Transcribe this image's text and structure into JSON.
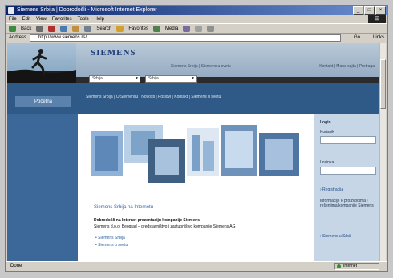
{
  "window": {
    "title": "Siemens Srbija | Dobrodošli - Microsoft Internet Explorer",
    "buttons": [
      "_",
      "□",
      "×"
    ]
  },
  "menu": {
    "items": [
      "File",
      "Edit",
      "View",
      "Favorites",
      "Tools",
      "Help"
    ]
  },
  "toolbar": {
    "back_label": "Back",
    "search_label": "Search",
    "favorites_label": "Favorites",
    "media_label": "Media"
  },
  "address": {
    "label": "Address",
    "url": "http://www.siemens.rs/",
    "go_label": "Go",
    "links_label": "Links"
  },
  "site": {
    "logo": "SIEMENS",
    "header_mid": "Siemens Srbija | Siemens u svetu",
    "header_right": "Kontakt | Mapa sajta | Pretraga",
    "select1": "Srbija",
    "select2": "Srbija",
    "nav_home": "Početna",
    "nav_links": "Siemens Srbija | O Siemensu | Novosti | Poslovi | Kontakt | Siemens u svetu",
    "promo_title": "Siemens Srbija na Internetu",
    "intro_line1": "Dobrodošli na Internet prezentaciju kompanije Siemens",
    "intro_line2": "Siemens d.o.o. Beograd – predstavništvo i zastupništvo kompanije Siemens AG",
    "bullets": [
      "Siemens Srbija",
      "Siemens u svetu"
    ],
    "sidebar": {
      "title": "Login",
      "user_label": "Korisnik",
      "pass_label": "Lozinka",
      "link1": "› Registracija",
      "text": "Informacije o proizvodima i rešenjima kompanije Siemens",
      "link2": "› Siemens u Srbiji"
    }
  },
  "status": {
    "left": "Done",
    "zone": "Internet"
  }
}
